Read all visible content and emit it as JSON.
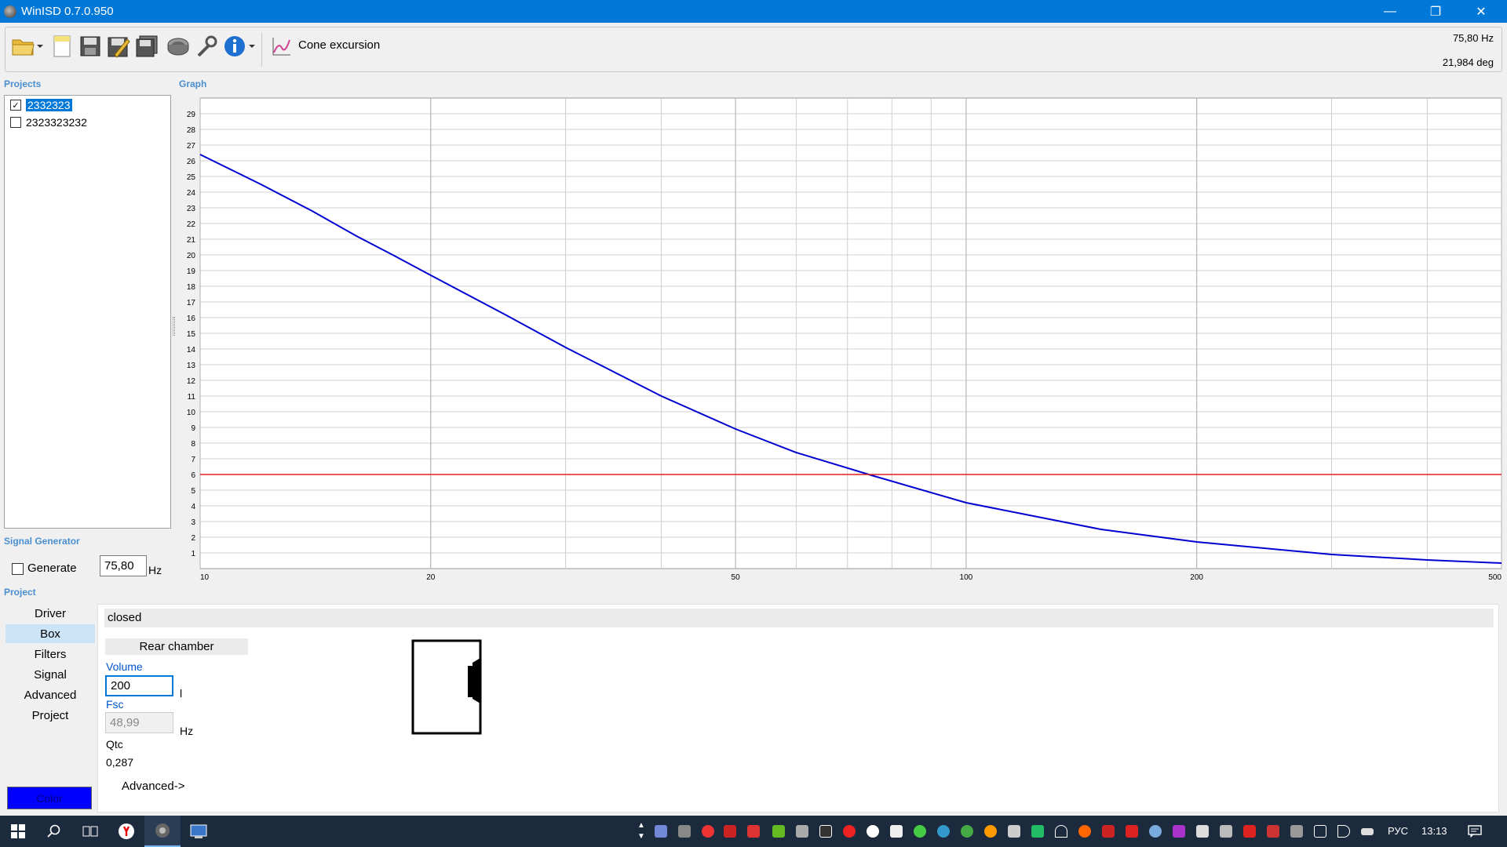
{
  "window": {
    "title": "WinISD 0.7.0.950"
  },
  "toolbar": {
    "active_graph_label": "Cone excursion",
    "readout_frequency": "75,80 Hz",
    "readout_phase": "21,984 deg",
    "icons": [
      "open-folder-icon",
      "new-file-icon",
      "save-icon",
      "save-as-icon",
      "save-all-icon",
      "driver-icon",
      "tools-icon",
      "info-icon",
      "graph-icon"
    ]
  },
  "sections": {
    "projects": "Projects",
    "graph": "Graph",
    "signal_generator": "Signal Generator",
    "project": "Project"
  },
  "projects": [
    {
      "name": "2332323",
      "checked": true,
      "selected": true
    },
    {
      "name": "2323323232",
      "checked": false,
      "selected": false
    }
  ],
  "signal_generator": {
    "generate_label": "Generate",
    "frequency": "75,80",
    "unit": "Hz"
  },
  "nav": {
    "items": [
      "Driver",
      "Box",
      "Filters",
      "Signal",
      "Advanced",
      "Project"
    ],
    "selected": "Box",
    "color_label": "Color",
    "color_value": "#0000ff"
  },
  "box": {
    "type": "closed",
    "rear_chamber": "Rear chamber",
    "volume_label": "Volume",
    "volume_value": "200",
    "volume_unit": "l",
    "fsc_label": "Fsc",
    "fsc_value": "48,99",
    "fsc_unit": "Hz",
    "qtc_label": "Qtc",
    "qtc_value": "0,287",
    "advanced_label": "Advanced->"
  },
  "chart_data": {
    "type": "line",
    "xscale": "log",
    "xlim": [
      10,
      500
    ],
    "ylim": [
      0,
      30
    ],
    "x_tick_labels": [
      "10",
      "20",
      "50",
      "100",
      "200",
      "500"
    ],
    "x_tick_values": [
      10,
      20,
      50,
      100,
      200,
      500
    ],
    "y_tick_values": [
      1,
      2,
      3,
      4,
      5,
      6,
      7,
      8,
      9,
      10,
      11,
      12,
      13,
      14,
      15,
      16,
      17,
      18,
      19,
      20,
      21,
      22,
      23,
      24,
      25,
      26,
      27,
      28,
      29
    ],
    "grid": true,
    "series": [
      {
        "color": "#0000d0",
        "x": [
          10,
          12,
          14,
          16,
          18,
          20,
          25,
          30,
          40,
          50,
          60,
          75.8,
          100,
          150,
          200,
          300,
          400,
          500
        ],
        "y": [
          26.4,
          24.5,
          22.8,
          21.2,
          19.9,
          18.7,
          16.2,
          14.1,
          11.0,
          8.9,
          7.4,
          5.9,
          4.2,
          2.5,
          1.7,
          0.9,
          0.55,
          0.35
        ]
      },
      {
        "color": "#e02020",
        "x": [
          10,
          500
        ],
        "y": [
          6,
          6
        ]
      }
    ]
  },
  "taskbar": {
    "language": "РУС",
    "time": "13:13"
  }
}
